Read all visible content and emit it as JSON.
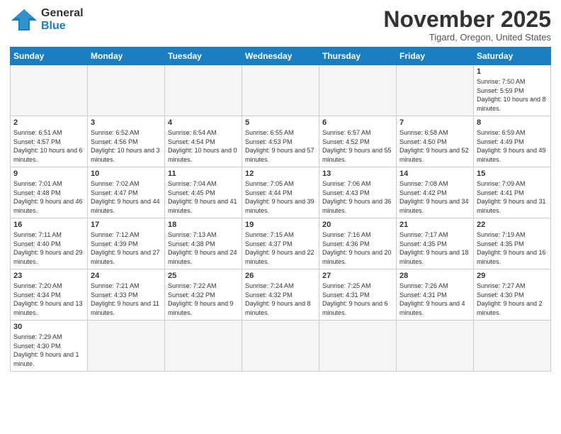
{
  "logo": {
    "text_general": "General",
    "text_blue": "Blue"
  },
  "header": {
    "month": "November 2025",
    "location": "Tigard, Oregon, United States"
  },
  "weekdays": [
    "Sunday",
    "Monday",
    "Tuesday",
    "Wednesday",
    "Thursday",
    "Friday",
    "Saturday"
  ],
  "weeks": [
    [
      {
        "day": "",
        "info": ""
      },
      {
        "day": "",
        "info": ""
      },
      {
        "day": "",
        "info": ""
      },
      {
        "day": "",
        "info": ""
      },
      {
        "day": "",
        "info": ""
      },
      {
        "day": "",
        "info": ""
      },
      {
        "day": "1",
        "info": "Sunrise: 7:50 AM\nSunset: 5:59 PM\nDaylight: 10 hours and 8 minutes."
      }
    ],
    [
      {
        "day": "2",
        "info": "Sunrise: 6:51 AM\nSunset: 4:57 PM\nDaylight: 10 hours and 6 minutes."
      },
      {
        "day": "3",
        "info": "Sunrise: 6:52 AM\nSunset: 4:56 PM\nDaylight: 10 hours and 3 minutes."
      },
      {
        "day": "4",
        "info": "Sunrise: 6:54 AM\nSunset: 4:54 PM\nDaylight: 10 hours and 0 minutes."
      },
      {
        "day": "5",
        "info": "Sunrise: 6:55 AM\nSunset: 4:53 PM\nDaylight: 9 hours and 57 minutes."
      },
      {
        "day": "6",
        "info": "Sunrise: 6:57 AM\nSunset: 4:52 PM\nDaylight: 9 hours and 55 minutes."
      },
      {
        "day": "7",
        "info": "Sunrise: 6:58 AM\nSunset: 4:50 PM\nDaylight: 9 hours and 52 minutes."
      },
      {
        "day": "8",
        "info": "Sunrise: 6:59 AM\nSunset: 4:49 PM\nDaylight: 9 hours and 49 minutes."
      }
    ],
    [
      {
        "day": "9",
        "info": "Sunrise: 7:01 AM\nSunset: 4:48 PM\nDaylight: 9 hours and 46 minutes."
      },
      {
        "day": "10",
        "info": "Sunrise: 7:02 AM\nSunset: 4:47 PM\nDaylight: 9 hours and 44 minutes."
      },
      {
        "day": "11",
        "info": "Sunrise: 7:04 AM\nSunset: 4:45 PM\nDaylight: 9 hours and 41 minutes."
      },
      {
        "day": "12",
        "info": "Sunrise: 7:05 AM\nSunset: 4:44 PM\nDaylight: 9 hours and 39 minutes."
      },
      {
        "day": "13",
        "info": "Sunrise: 7:06 AM\nSunset: 4:43 PM\nDaylight: 9 hours and 36 minutes."
      },
      {
        "day": "14",
        "info": "Sunrise: 7:08 AM\nSunset: 4:42 PM\nDaylight: 9 hours and 34 minutes."
      },
      {
        "day": "15",
        "info": "Sunrise: 7:09 AM\nSunset: 4:41 PM\nDaylight: 9 hours and 31 minutes."
      }
    ],
    [
      {
        "day": "16",
        "info": "Sunrise: 7:11 AM\nSunset: 4:40 PM\nDaylight: 9 hours and 29 minutes."
      },
      {
        "day": "17",
        "info": "Sunrise: 7:12 AM\nSunset: 4:39 PM\nDaylight: 9 hours and 27 minutes."
      },
      {
        "day": "18",
        "info": "Sunrise: 7:13 AM\nSunset: 4:38 PM\nDaylight: 9 hours and 24 minutes."
      },
      {
        "day": "19",
        "info": "Sunrise: 7:15 AM\nSunset: 4:37 PM\nDaylight: 9 hours and 22 minutes."
      },
      {
        "day": "20",
        "info": "Sunrise: 7:16 AM\nSunset: 4:36 PM\nDaylight: 9 hours and 20 minutes."
      },
      {
        "day": "21",
        "info": "Sunrise: 7:17 AM\nSunset: 4:35 PM\nDaylight: 9 hours and 18 minutes."
      },
      {
        "day": "22",
        "info": "Sunrise: 7:19 AM\nSunset: 4:35 PM\nDaylight: 9 hours and 16 minutes."
      }
    ],
    [
      {
        "day": "23",
        "info": "Sunrise: 7:20 AM\nSunset: 4:34 PM\nDaylight: 9 hours and 13 minutes."
      },
      {
        "day": "24",
        "info": "Sunrise: 7:21 AM\nSunset: 4:33 PM\nDaylight: 9 hours and 11 minutes."
      },
      {
        "day": "25",
        "info": "Sunrise: 7:22 AM\nSunset: 4:32 PM\nDaylight: 9 hours and 9 minutes."
      },
      {
        "day": "26",
        "info": "Sunrise: 7:24 AM\nSunset: 4:32 PM\nDaylight: 9 hours and 8 minutes."
      },
      {
        "day": "27",
        "info": "Sunrise: 7:25 AM\nSunset: 4:31 PM\nDaylight: 9 hours and 6 minutes."
      },
      {
        "day": "28",
        "info": "Sunrise: 7:26 AM\nSunset: 4:31 PM\nDaylight: 9 hours and 4 minutes."
      },
      {
        "day": "29",
        "info": "Sunrise: 7:27 AM\nSunset: 4:30 PM\nDaylight: 9 hours and 2 minutes."
      }
    ],
    [
      {
        "day": "30",
        "info": "Sunrise: 7:29 AM\nSunset: 4:30 PM\nDaylight: 9 hours and 1 minute."
      },
      {
        "day": "",
        "info": ""
      },
      {
        "day": "",
        "info": ""
      },
      {
        "day": "",
        "info": ""
      },
      {
        "day": "",
        "info": ""
      },
      {
        "day": "",
        "info": ""
      },
      {
        "day": "",
        "info": ""
      }
    ]
  ]
}
